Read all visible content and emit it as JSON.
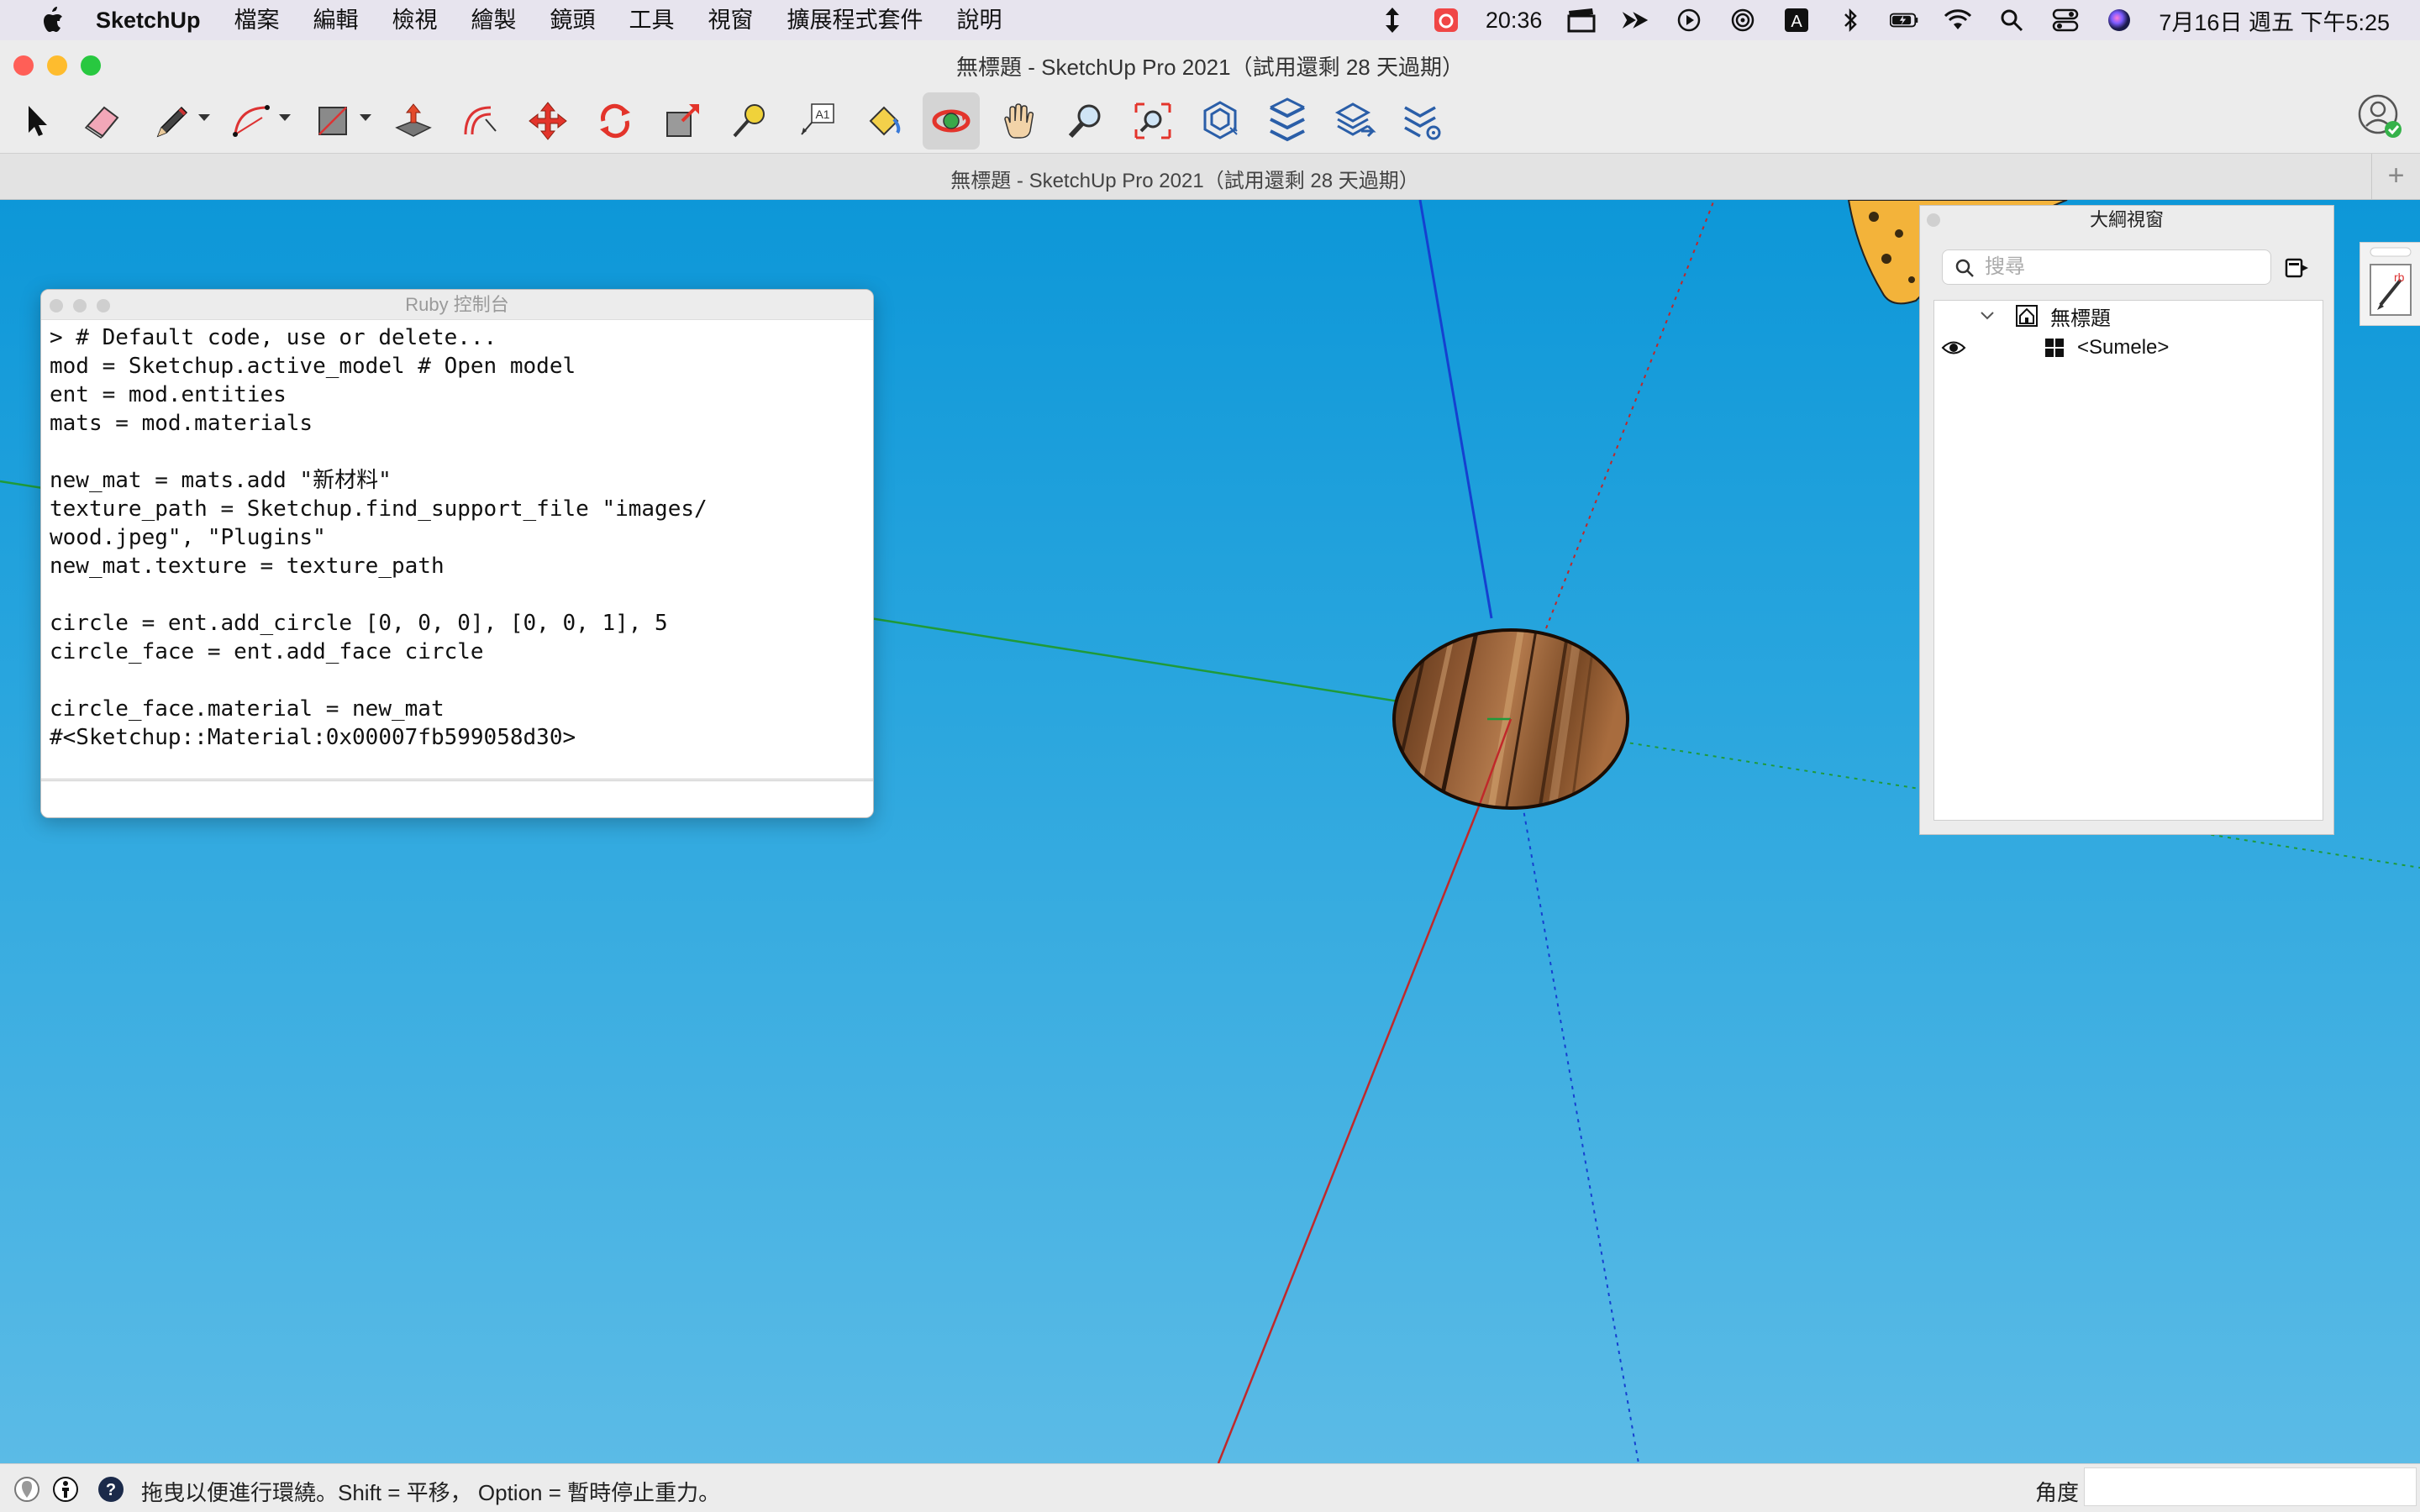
{
  "menubar": {
    "app_name": "SketchUp",
    "items": [
      "檔案",
      "編輯",
      "檢視",
      "繪製",
      "鏡頭",
      "工具",
      "視窗",
      "擴展程式套件",
      "說明"
    ],
    "status": {
      "clock": "20:36",
      "date_time": "7月16日 週五 下午5:25",
      "input_method": "A"
    }
  },
  "window": {
    "title": "無標題 - SketchUp Pro 2021（試用還剩 28 天過期）",
    "tab_title": "無標題 - SketchUp Pro 2021（試用還剩 28 天過期）",
    "tab_add": "+",
    "colors": {
      "close": "#ff5f57",
      "minimize": "#febc2e",
      "zoom": "#28c840"
    }
  },
  "toolbar": {
    "active_tool": "orbit"
  },
  "ruby_console": {
    "title": "Ruby 控制台",
    "output": "> # Default code, use or delete...\nmod = Sketchup.active_model # Open model\nent = mod.entities\nmats = mod.materials\n\nnew_mat = mats.add \"新材料\"\ntexture_path = Sketchup.find_support_file \"images/\nwood.jpeg\", \"Plugins\"\nnew_mat.texture = texture_path\n\ncircle = ent.add_circle [0, 0, 0], [0, 0, 1], 5\ncircle_face = ent.add_face circle\n\ncircle_face.material = new_mat\n#<Sketchup::Material:0x00007fb599058d30>",
    "input_value": ""
  },
  "outliner": {
    "title": "大綱視窗",
    "search_placeholder": "搜尋",
    "model_name": "無標題",
    "component_name": "<Sumele>"
  },
  "statusbar": {
    "hint": "拖曳以便進行環繞。Shift = 平移， Option = 暫時停止重力。",
    "vcb_label": "角度",
    "vcb_value": ""
  },
  "colors": {
    "sky_top": "#0d97d8",
    "sky_bottom": "#5bbbe6",
    "axis_red": "#c0282a",
    "axis_green": "#1f9a3a",
    "axis_blue": "#1540d0",
    "wood": "#8a5530"
  }
}
